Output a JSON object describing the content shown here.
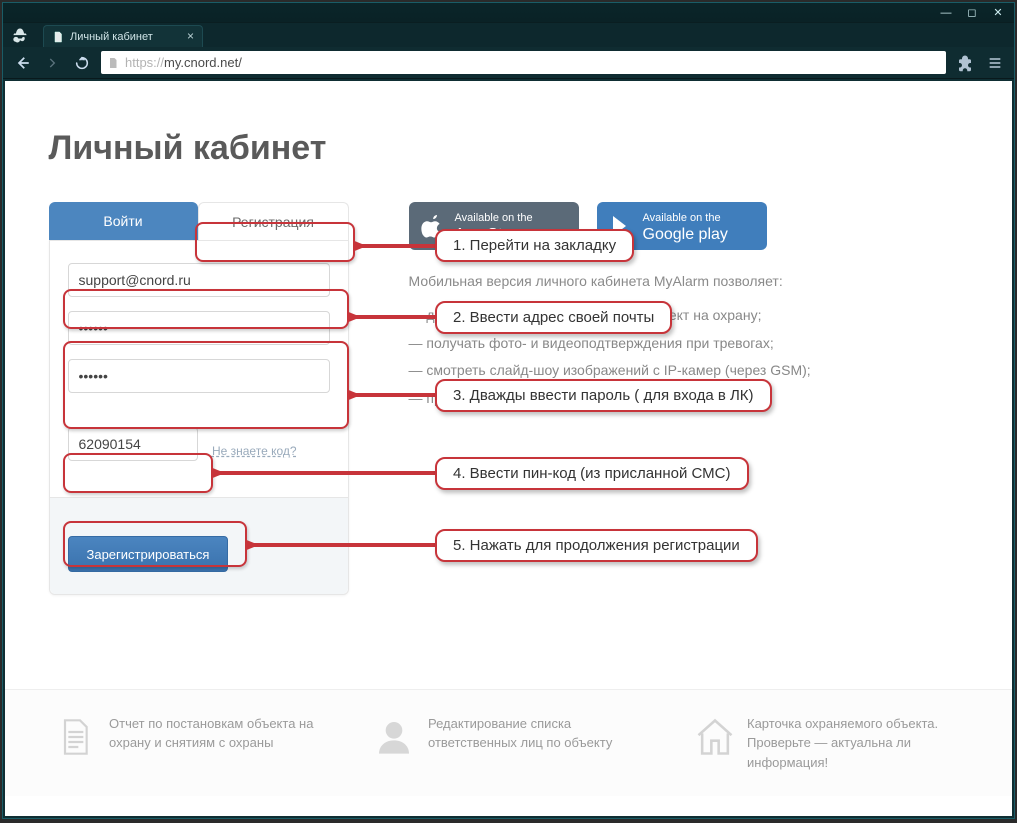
{
  "browser": {
    "tab_title": "Личный кабинет",
    "url_full": "https://my.cnord.net/",
    "url_proto": "https://",
    "url_rest": "my.cnord.net/"
  },
  "page": {
    "title": "Личный кабинет"
  },
  "tabs": {
    "login": "Войти",
    "register": "Регистрация"
  },
  "form": {
    "email_value": "support@cnord.ru",
    "password1_value": "••••••",
    "password2_value": "••••••",
    "pin_value": "62090154",
    "know_code_label": "Не знаете код?",
    "submit_label": "Зарегистрироваться"
  },
  "stores": {
    "apple_small": "Available on the",
    "apple_big": "App Store",
    "google_small": "Available on the",
    "google_big": "Google play"
  },
  "rightcol": {
    "lead": "Мобильная версия личного кабинета MyAlarm позволяет:",
    "b1": "— дистанционно снимать и ставить объект на охрану;",
    "b2": "— получать фото- и видеоподтверждения при тревогах;",
    "b3": "— смотреть слайд-шоу изображений с IP-камер (через GSM);",
    "b4": "— просматривать историю снятий и постановок."
  },
  "features": {
    "f1": "Отчет по постановкам объекта на охрану и снятиям с охраны",
    "f2": "Редактирование списка ответственных лиц по объекту",
    "f3": "Карточка охраняемого объекта. Проверьте — актуальна ли информация!"
  },
  "callouts": {
    "c1": "1. Перейти на закладку",
    "c2": "2. Ввести адрес своей почты",
    "c3": "3. Дважды ввести пароль ( для входа в ЛК)",
    "c4": "4. Ввести пин-код (из присланной СМС)",
    "c5": "5. Нажать для продолжения регистрации"
  }
}
